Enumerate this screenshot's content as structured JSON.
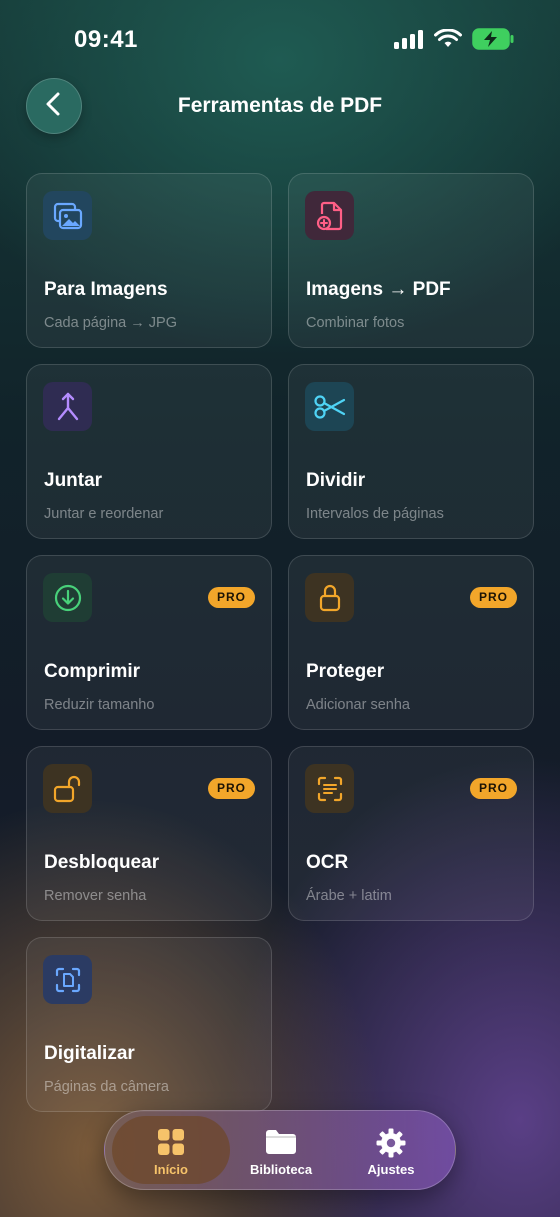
{
  "status_bar": {
    "time": "09:41"
  },
  "header": {
    "title": "Ferramentas de PDF"
  },
  "tools": [
    {
      "name": "Para Imagens",
      "desc": "Cada página → JPG",
      "icon": "image-gallery-icon",
      "pro": false
    },
    {
      "name": "Imagens → PDF",
      "desc": "Combinar fotos",
      "icon": "file-add-icon",
      "pro": false
    },
    {
      "name": "Juntar",
      "desc": "Juntar e reordenar",
      "icon": "merge-arrow-icon",
      "pro": false
    },
    {
      "name": "Dividir",
      "desc": "Intervalos de páginas",
      "icon": "scissors-icon",
      "pro": false
    },
    {
      "name": "Comprimir",
      "desc": "Reduzir tamanho",
      "icon": "download-circle-icon",
      "pro": true
    },
    {
      "name": "Proteger",
      "desc": "Adicionar senha",
      "icon": "lock-icon",
      "pro": true
    },
    {
      "name": "Desbloquear",
      "desc": "Remover senha",
      "icon": "unlock-icon",
      "pro": true
    },
    {
      "name": "OCR",
      "desc": "Árabe + latim",
      "icon": "text-scan-icon",
      "pro": true
    },
    {
      "name": "Digitalizar",
      "desc": "Páginas da câmera",
      "icon": "document-scan-icon",
      "pro": false
    }
  ],
  "badge_label": "PRO",
  "tabbar": {
    "tabs": [
      {
        "label": "Início",
        "icon": "grid-icon",
        "active": true
      },
      {
        "label": "Biblioteca",
        "icon": "folder-icon",
        "active": false
      },
      {
        "label": "Ajustes",
        "icon": "gear-icon",
        "active": false
      }
    ]
  },
  "colors": {
    "accent_pro": "#f2a62a",
    "active_tab": "#f6c36a"
  }
}
